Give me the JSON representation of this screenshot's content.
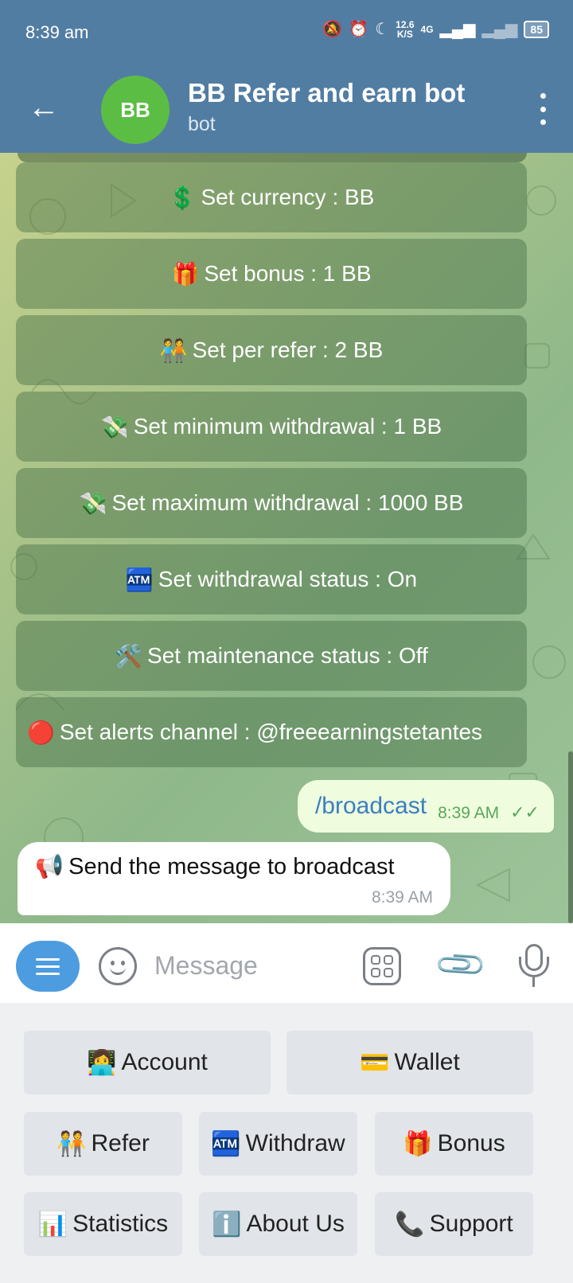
{
  "status_bar": {
    "time": "8:39 am",
    "speed_value": "12.6",
    "speed_unit": "K/S",
    "network": "4G",
    "battery": "85"
  },
  "header": {
    "avatar_initials": "BB",
    "title": "BB Refer and earn bot",
    "subtitle": "bot"
  },
  "inline_keyboard": [
    {
      "emoji": "💲",
      "label": "Set currency : BB"
    },
    {
      "emoji": "🎁",
      "label": "Set bonus : 1 BB"
    },
    {
      "emoji": "🧑‍🤝‍🧑",
      "label": "Set per refer : 2 BB"
    },
    {
      "emoji": "💸",
      "label": "Set minimum withdrawal : 1 BB"
    },
    {
      "emoji": "💸",
      "label": "Set maximum withdrawal : 1000 BB"
    },
    {
      "emoji": "🏧",
      "label": "Set withdrawal status : On"
    },
    {
      "emoji": "🛠️",
      "label": "Set maintenance status : Off"
    },
    {
      "emoji": "🔴",
      "label": "Set alerts channel : @freeearningstetantes"
    }
  ],
  "messages": {
    "outgoing": {
      "text": "/broadcast",
      "time": "8:39 AM",
      "ticks": "✓✓"
    },
    "incoming": {
      "emoji": "📢",
      "text": "Send the message to broadcast",
      "time": "8:39 AM"
    }
  },
  "input": {
    "placeholder": "Message"
  },
  "reply_keyboard": {
    "account": {
      "emoji": "👩‍💻",
      "label": "Account"
    },
    "wallet": {
      "emoji": "💳",
      "label": "Wallet"
    },
    "refer": {
      "emoji": "🧑‍🤝‍🧑",
      "label": "Refer"
    },
    "withdraw": {
      "emoji": "🏧",
      "label": "Withdraw"
    },
    "bonus": {
      "emoji": "🎁",
      "label": "Bonus"
    },
    "statistics": {
      "emoji": "📊",
      "label": "Statistics"
    },
    "about": {
      "emoji": "ℹ️",
      "label": "About Us"
    },
    "support": {
      "emoji": "📞",
      "label": "Support"
    }
  }
}
